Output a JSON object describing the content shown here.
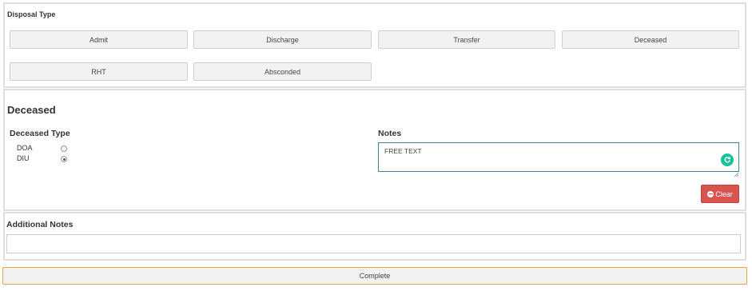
{
  "disposal": {
    "title": "Disposal Type",
    "buttons": [
      "Admit",
      "Discharge",
      "Transfer",
      "Deceased",
      "RHT",
      "Absconded"
    ]
  },
  "deceased": {
    "heading": "Deceased",
    "type_label": "Deceased Type",
    "options": [
      {
        "label": "DOA",
        "checked": false
      },
      {
        "label": "DIU",
        "checked": true
      }
    ],
    "notes_label": "Notes",
    "notes_value": "FREE TEXT",
    "clear_label": "Clear",
    "clear_color": "#d9534f"
  },
  "additional": {
    "label": "Additional Notes",
    "value": ""
  },
  "complete_label": "Complete",
  "accent_colors": {
    "complete_border": "#e8a33d",
    "notes_border": "#3a8a96",
    "grammarly": "#15c39a"
  },
  "icons": {
    "clear": "minus-circle-icon",
    "notes_assist": "grammarly-icon"
  }
}
